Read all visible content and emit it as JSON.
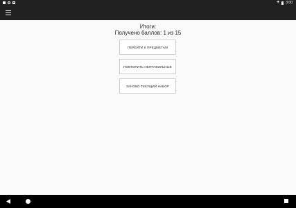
{
  "status_bar": {
    "time": "3:00",
    "left_icons": [
      "notification-square-icon",
      "settings-circle-icon",
      "download-icon"
    ],
    "right_icons": [
      "plus-icon",
      "battery-icon"
    ]
  },
  "app_bar": {
    "menu_icon": "hamburger-menu-icon"
  },
  "results": {
    "title": "Итоги:",
    "score": "Получено баллов: 1 из 15"
  },
  "buttons": {
    "go_to_subjects": "ПЕРЕЙТИ К ПРЕДМЕТАМ",
    "repeat_wrong": "ПОВТОРИТЬ НЕПРАВИЛЬНЫЕ",
    "restart_set": "ЗАНОВО ТЕКУЩИЙ НАБОР"
  },
  "nav_bar": {
    "icons": [
      "back-icon",
      "home-icon",
      "recents-icon"
    ]
  },
  "colors": {
    "bar": "#212121",
    "background": "#fafafa",
    "button_border": "#cfcfcf",
    "nav": "#000000"
  }
}
